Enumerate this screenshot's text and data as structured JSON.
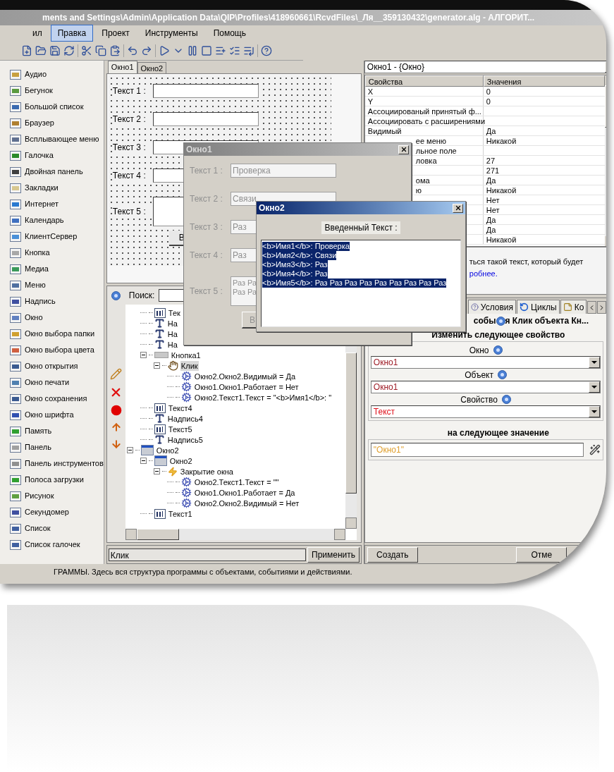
{
  "window": {
    "title": "ments and Settings\\Admin\\Application Data\\QIP\\Profiles\\418960661\\RcvdFiles\\_Ля__359130432\\generator.alg - АЛГОРИТ..."
  },
  "menu": [
    {
      "label": "ил",
      "selected": false
    },
    {
      "label": "Правка",
      "selected": true
    },
    {
      "label": "Проект",
      "selected": false
    },
    {
      "label": "Инструменты",
      "selected": false
    },
    {
      "label": "Помощь",
      "selected": false
    }
  ],
  "palette": [
    "Аудио",
    "Бегунок",
    "Большой список",
    "Браузер",
    "Всплывающее меню",
    "Галочка",
    "Двойная панель",
    "Закладки",
    "Интернет",
    "Календарь",
    "КлиентСервер",
    "Кнопка",
    "Медиа",
    "Меню",
    "Надпись",
    "Окно",
    "Окно выбора папки",
    "Окно выбора цвета",
    "Окно открытия",
    "Окно печати",
    "Окно сохранения",
    "Окно шрифта",
    "Память",
    "Панель",
    "Панель инструментов",
    "Полоса загрузки",
    "Рисунок",
    "Секундомер",
    "Список",
    "Список галочек"
  ],
  "designer": {
    "tabs": [
      {
        "label": "Окно1",
        "selected": true
      },
      {
        "label": "Окно2",
        "selected": false
      }
    ],
    "fields": [
      {
        "label": "Текст 1 :",
        "kind": "line"
      },
      {
        "label": "Текст 2 :",
        "kind": "line"
      },
      {
        "label": "Текст 3 :",
        "kind": "line"
      },
      {
        "label": "Текст 4 :",
        "kind": "line"
      },
      {
        "label": "Текст 5 :",
        "kind": "area"
      }
    ],
    "button": "В"
  },
  "tree": {
    "search_label": "Поиск:",
    "items": [
      {
        "kind": "offscreen",
        "children": [
          {
            "label": "Тек",
            "kind": "textbox",
            "selected": false
          },
          {
            "label": "На",
            "kind": "label",
            "selected": false
          },
          {
            "label": "На",
            "kind": "label",
            "selected": false
          },
          {
            "label": "На",
            "kind": "label",
            "selected": false
          },
          {
            "label": "Кнопка1",
            "kind": "button",
            "selected": false,
            "expanded": true,
            "children": [
              {
                "label": "Клик",
                "kind": "click",
                "selected": true,
                "expanded": true,
                "children": [
                  {
                    "label": "Окно2.Окно2.Видимый = Да",
                    "kind": "action",
                    "selected": false
                  },
                  {
                    "label": "Окно1.Окно1.Работает = Нет",
                    "kind": "action",
                    "selected": false
                  },
                  {
                    "label": "Окно2.Текст1.Текст = \"<b>Имя1</b>: \"",
                    "kind": "action",
                    "selected": false
                  }
                ]
              }
            ]
          },
          {
            "label": "Текст4",
            "kind": "textbox",
            "selected": false
          },
          {
            "label": "Надпись4",
            "kind": "label",
            "selected": false
          },
          {
            "label": "Текст5",
            "kind": "textbox",
            "selected": false
          },
          {
            "label": "Надпись5",
            "kind": "label",
            "selected": false
          }
        ]
      },
      {
        "label": "Окно2",
        "kind": "window",
        "selected": false,
        "expanded": true,
        "children": [
          {
            "label": "Окно2",
            "kind": "window",
            "selected": false,
            "expanded": true,
            "children": [
              {
                "label": "Закрытие окна",
                "kind": "closing",
                "selected": false,
                "expanded": true,
                "children": [
                  {
                    "label": "Окно2.Текст1.Текст = \"\"",
                    "kind": "action",
                    "selected": false
                  },
                  {
                    "label": "Окно1.Окно1.Работает = Да",
                    "kind": "action",
                    "selected": false
                  },
                  {
                    "label": "Окно2.Окно2.Видимый = Нет",
                    "kind": "action",
                    "selected": false
                  }
                ]
              }
            ]
          },
          {
            "label": "Текст1",
            "kind": "textbox",
            "selected": false
          }
        ]
      }
    ],
    "name_value": "Клик",
    "apply_button": "Применить"
  },
  "properties": {
    "object": "Окно1 - {Окно}",
    "columns": [
      "Свойства",
      "Значения"
    ],
    "rows": [
      {
        "name": "X",
        "value": "0"
      },
      {
        "name": "Y",
        "value": "0"
      },
      {
        "name": "Ассоциированый принятый ф...",
        "value": ""
      },
      {
        "name": "Ассоциировать с расширениями",
        "value": ""
      },
      {
        "name": "Видимый",
        "value": "Да"
      },
      {
        "name": "ее меню",
        "value": "Никакой",
        "covered": true
      },
      {
        "name": "льное поле",
        "value": "",
        "covered": true
      },
      {
        "name": "ловка",
        "value": "27",
        "covered": true
      },
      {
        "value": "271"
      },
      {
        "name": "ома",
        "value": "Да",
        "covered": true
      },
      {
        "name": "ю",
        "value": "Никакой",
        "covered": true
      },
      {
        "value": "Нет"
      },
      {
        "value": "Нет"
      },
      {
        "value": "Да"
      },
      {
        "value": "Да"
      },
      {
        "value": "Никакой"
      }
    ],
    "description": "ться такой текст, который будет",
    "description_link": "робнее."
  },
  "event": {
    "tabs": [
      {
        "label": "Условия",
        "selected": false
      },
      {
        "label": "Циклы",
        "selected": false
      },
      {
        "label": "Ко",
        "selected": false
      }
    ],
    "header_start": "собы",
    "header_end": "я Клик объекта Кн...",
    "section": "Изменить следующее свойство",
    "fields": [
      {
        "label": "Окно",
        "value": "Окно1",
        "color": "#a0202a"
      },
      {
        "label": "Объект",
        "value": "Окно1",
        "color": "#a0202a"
      },
      {
        "label": "Свойство",
        "value": "Текст",
        "color": "#e0101a"
      }
    ],
    "value_title": "на следующее значение",
    "value": "\"Окно1\"",
    "buttons": [
      "Создать",
      "Отме"
    ]
  },
  "status_bar": "ГРАММЫ. Здесь вся структура программы с объектами, событиями и действиями.",
  "dialog1": {
    "title": "Окно1",
    "disabled": true,
    "fields": [
      {
        "label": "Текст 1 :",
        "value": "Проверка"
      },
      {
        "label": "Текст 2 :",
        "value": "Связи"
      },
      {
        "label": "Текст 3 :",
        "value": "Раз"
      },
      {
        "label": "Текст 4 :",
        "value": "Раз"
      }
    ],
    "area_label": "Текст 5 :",
    "area_lines": [
      "Раз Ра",
      "Раз Ра"
    ],
    "button": "В"
  },
  "dialog2": {
    "title": "Окно2",
    "label": "Введенный Текст :",
    "items": [
      {
        "text": "<b>Имя1</b>: Проверка",
        "selected": true
      },
      {
        "text": "<b>Имя2</b>: Связи",
        "selected": true
      },
      {
        "text": "<b>Имя3</b>: Раз",
        "selected": true
      },
      {
        "text": "<b>Имя4</b>: Раз",
        "selected": true
      },
      {
        "text": "<b>Имя5</b>: Раз Раз Раз Раз Раз Раз Раз Раз Раз",
        "selected": true
      }
    ]
  }
}
